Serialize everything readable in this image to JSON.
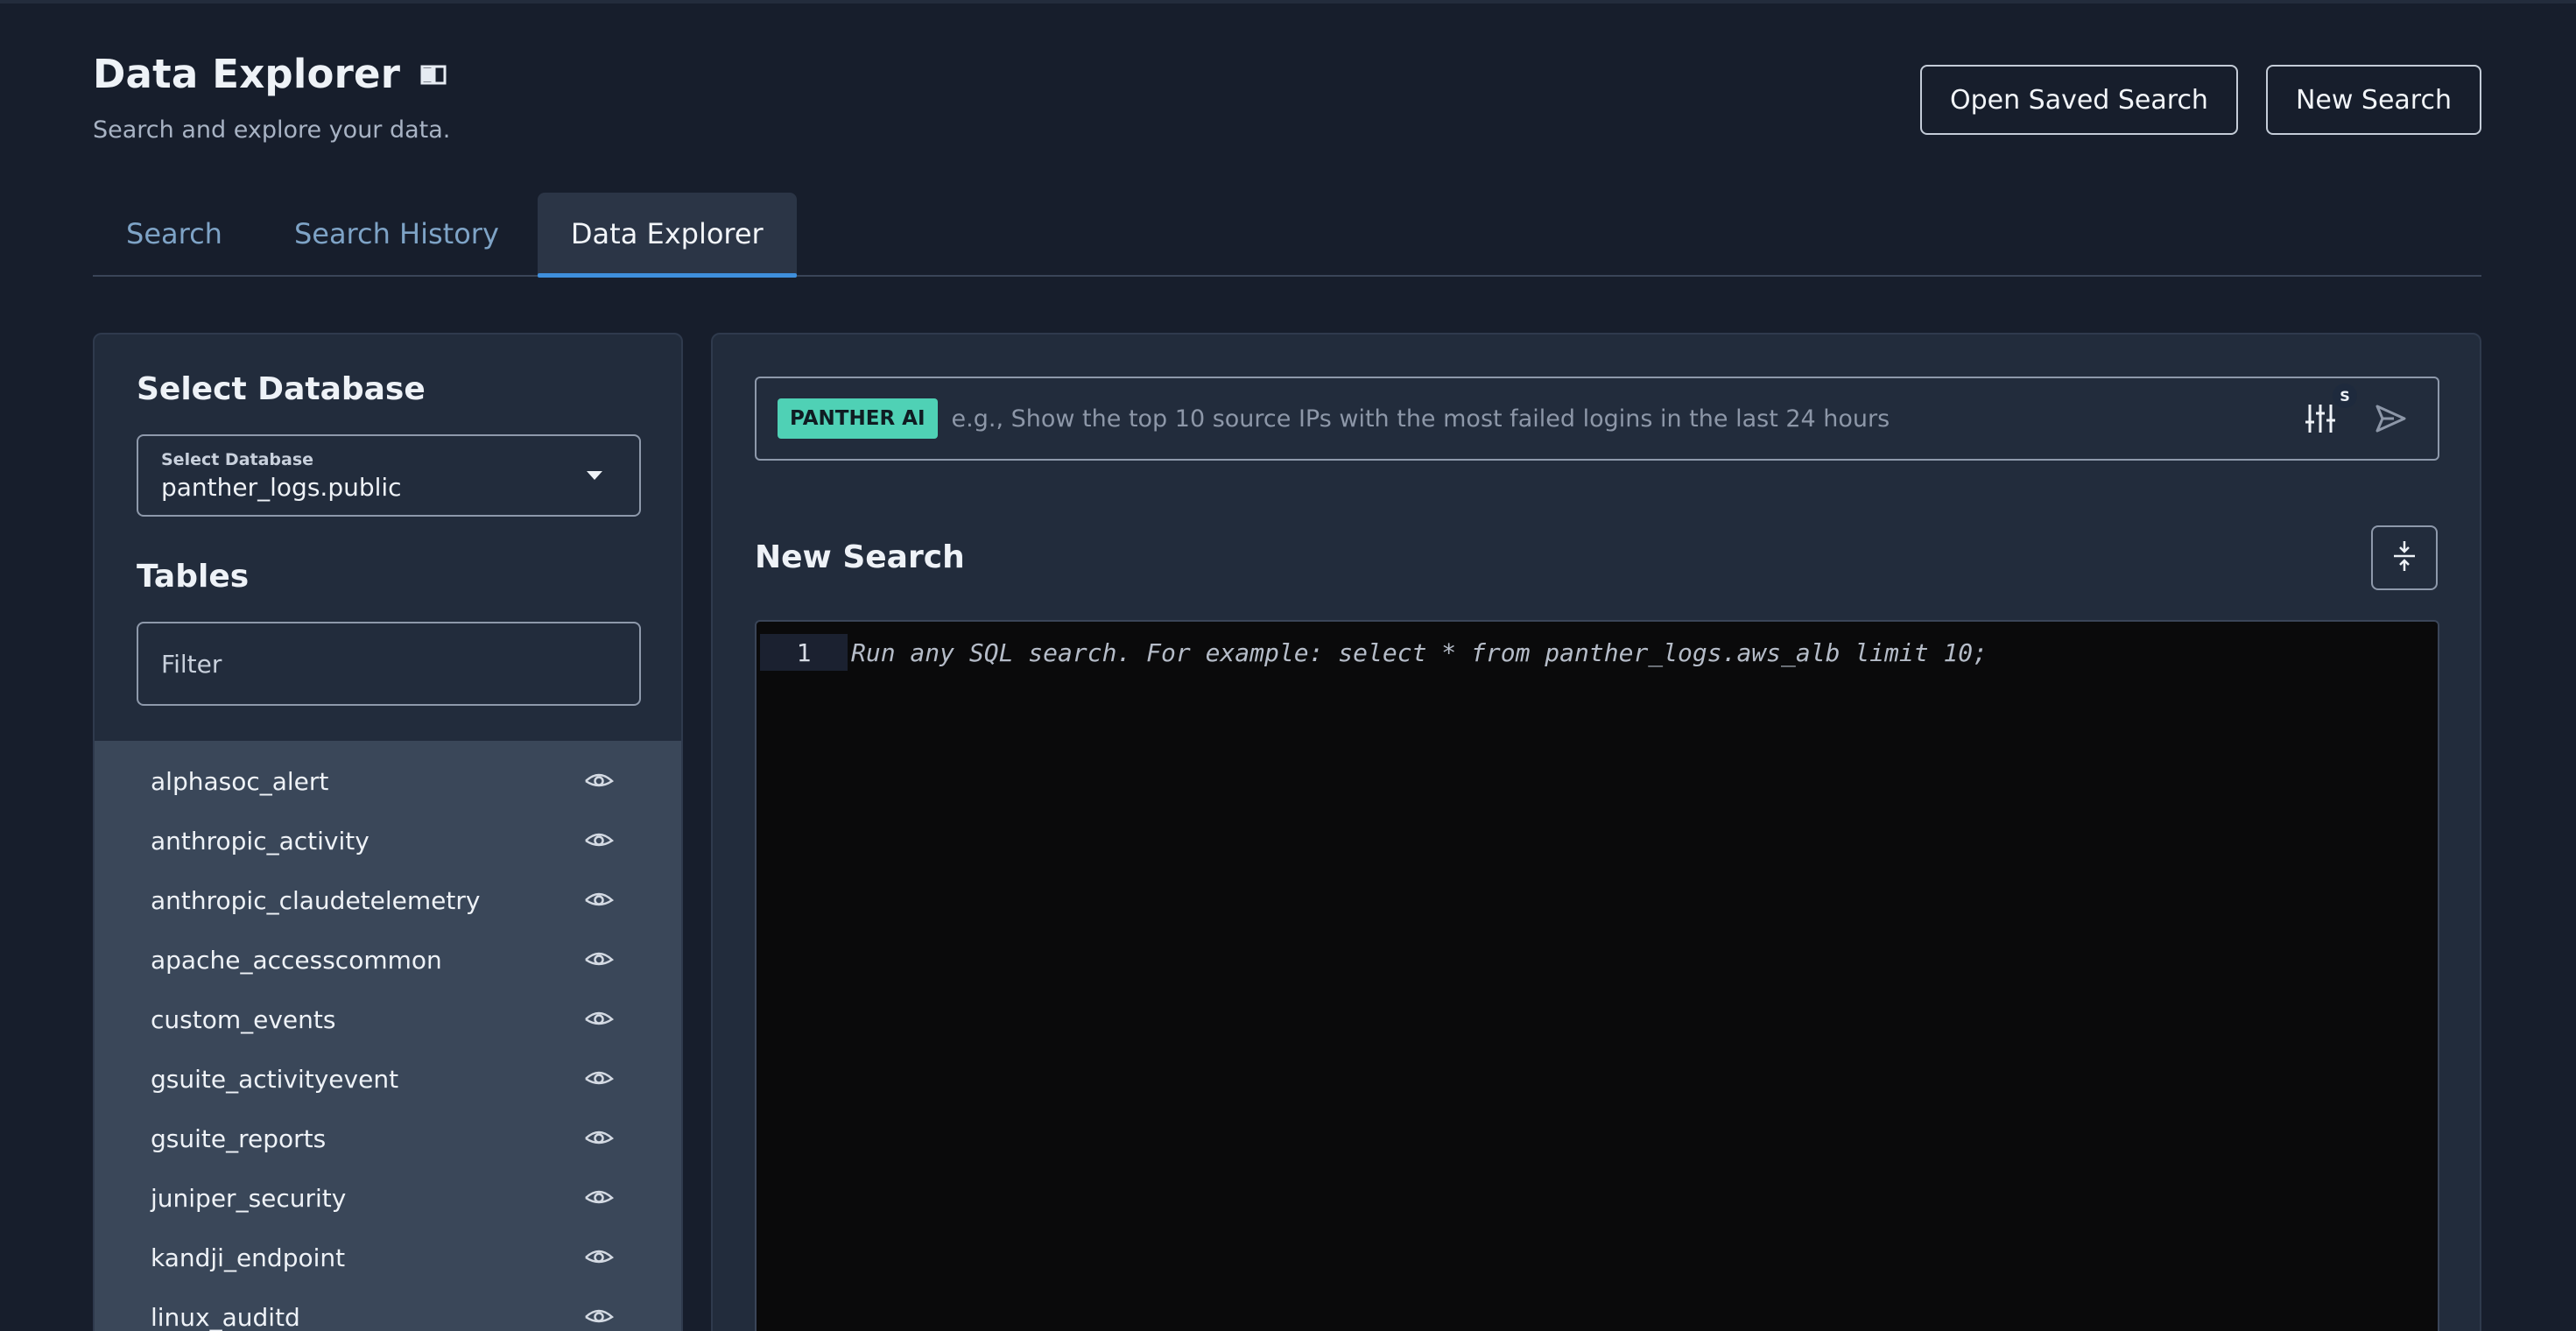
{
  "header": {
    "title": "Data Explorer",
    "subtitle": "Search and explore your data.",
    "actions": {
      "open_saved": "Open Saved Search",
      "new_search": "New Search"
    }
  },
  "tabs": [
    {
      "label": "Search"
    },
    {
      "label": "Search History"
    },
    {
      "label": "Data Explorer",
      "active": true
    }
  ],
  "left_panel": {
    "select_heading": "Select Database",
    "select_label": "Select Database",
    "select_value": "panther_logs.public",
    "tables_heading": "Tables",
    "filter_placeholder": "Filter",
    "tables": [
      {
        "name": "alphasoc_alert"
      },
      {
        "name": "anthropic_activity"
      },
      {
        "name": "anthropic_claudetelemetry"
      },
      {
        "name": "apache_accesscommon"
      },
      {
        "name": "custom_events"
      },
      {
        "name": "gsuite_activityevent"
      },
      {
        "name": "gsuite_reports"
      },
      {
        "name": "juniper_security"
      },
      {
        "name": "kandji_endpoint"
      },
      {
        "name": "linux_auditd"
      }
    ]
  },
  "right_panel": {
    "ai_badge": "PANTHER AI",
    "ai_placeholder": "e.g., Show the top 10 source IPs with the most failed logins in the last 24 hours",
    "ai_settings_badge": "S",
    "search_title": "New Search",
    "editor": {
      "line_number": "1",
      "placeholder": "Run any SQL search. For example: select * from panther_logs.aws_alb limit 10;"
    }
  },
  "colors": {
    "background": "#171e2c",
    "panel": "#222c3c",
    "table_list": "#3a4759",
    "accent": "#3f8fdc",
    "ai_badge": "#4fd1b5",
    "tab_inactive": "#7ea3c6",
    "editor_bg": "#0a0a0b"
  },
  "icons": [
    "book-icon",
    "eye-icon",
    "sliders-icon",
    "send-icon",
    "collapse-icon",
    "chevron-down-icon"
  ]
}
